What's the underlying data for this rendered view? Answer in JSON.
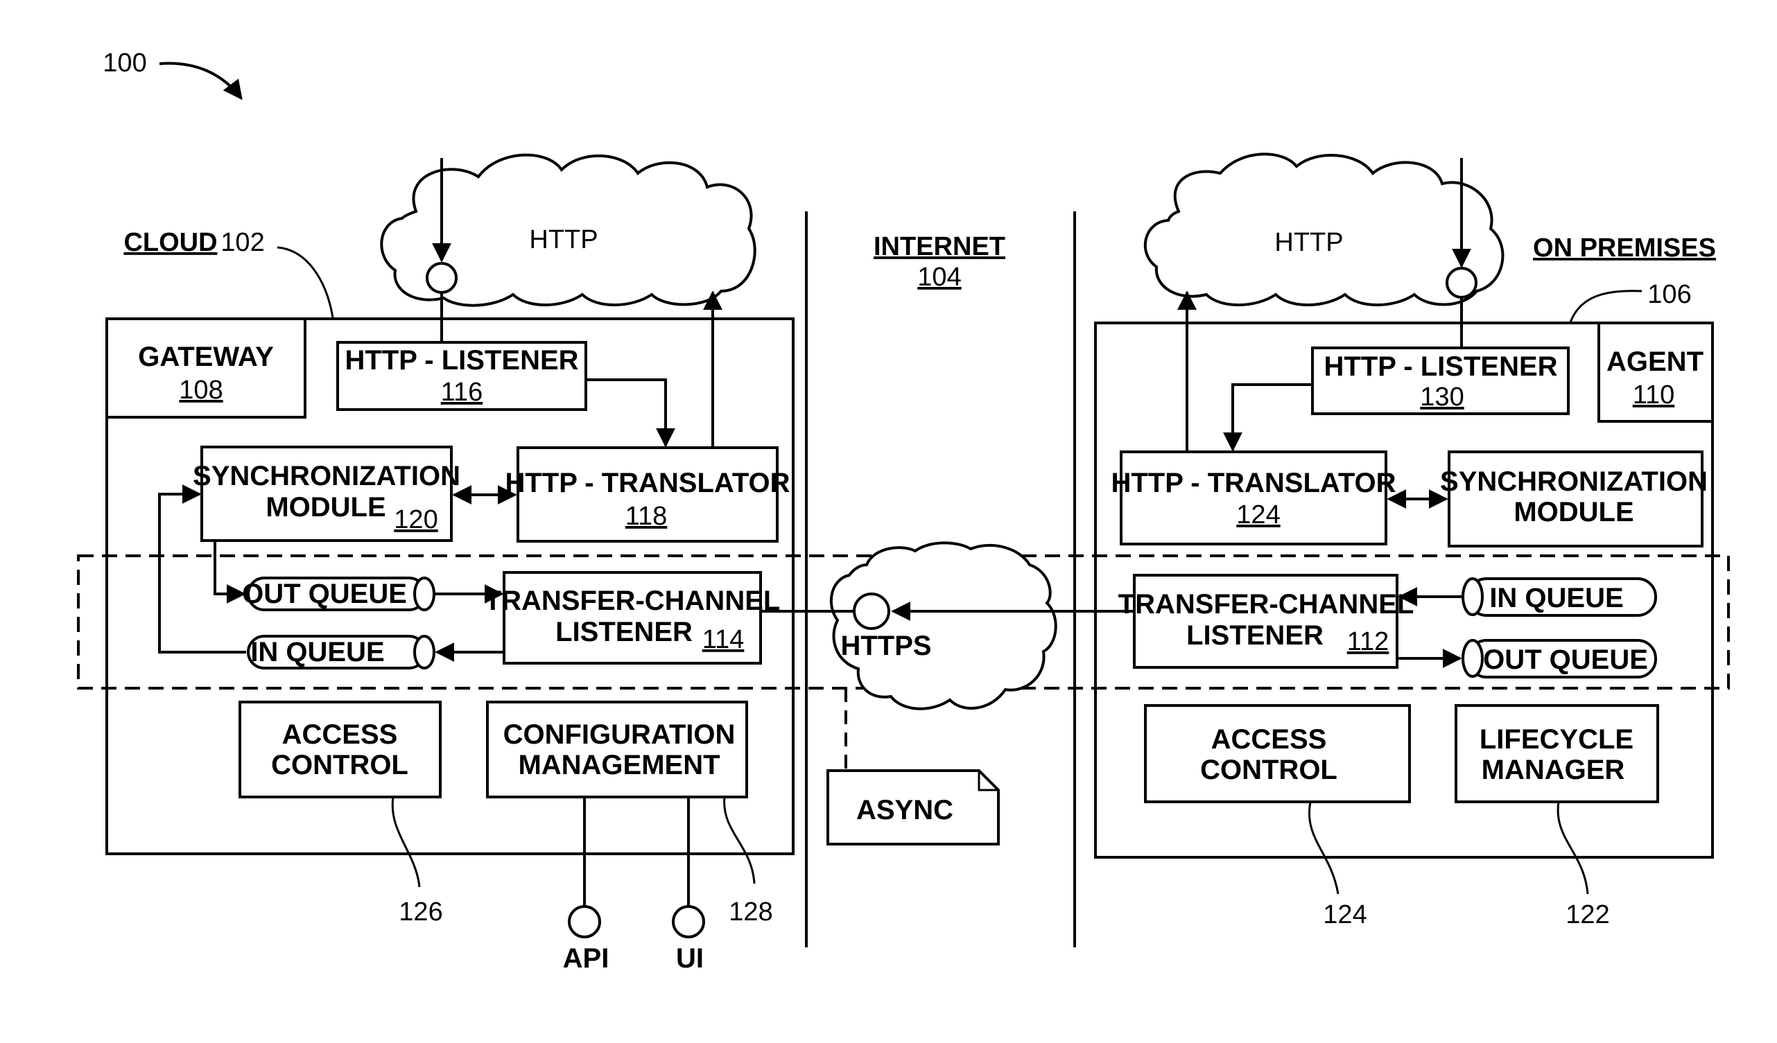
{
  "figure": {
    "ref": "100",
    "zones": {
      "cloud": {
        "label": "CLOUD",
        "ref": "102"
      },
      "internet": {
        "label": "INTERNET",
        "ref": "104"
      },
      "on_premises": {
        "label": "ON PREMISES",
        "ref": "106"
      }
    },
    "clouds": {
      "http_left": "HTTP",
      "http_right": "HTTP",
      "https": "HTTPS"
    },
    "left": {
      "gateway": {
        "label": "GATEWAY",
        "ref": "108"
      },
      "http_listener": {
        "label": "HTTP - LISTENER",
        "ref": "116"
      },
      "sync_module": {
        "line1": "SYNCHRONIZATION",
        "line2": "MODULE",
        "ref": "120"
      },
      "http_translator": {
        "label": "HTTP - TRANSLATOR",
        "ref": "118"
      },
      "out_queue": "OUT QUEUE",
      "in_queue": "IN QUEUE",
      "transfer_listener": {
        "line1": "TRANSFER-CHANNEL",
        "line2": "LISTENER",
        "ref": "114"
      },
      "access_control": {
        "line1": "ACCESS",
        "line2": "CONTROL",
        "ref": "126"
      },
      "config_mgmt": {
        "line1": "CONFIGURATION",
        "line2": "MANAGEMENT",
        "ref": "128"
      },
      "api": "API",
      "ui": "UI"
    },
    "middle": {
      "async": "ASYNC"
    },
    "right": {
      "agent": {
        "label": "AGENT",
        "ref": "110"
      },
      "http_listener": {
        "label": "HTTP - LISTENER",
        "ref": "130"
      },
      "http_translator": {
        "label": "HTTP - TRANSLATOR",
        "ref": "124"
      },
      "sync_module": {
        "line1": "SYNCHRONIZATION",
        "line2": "MODULE"
      },
      "transfer_listener": {
        "line1": "TRANSFER-CHANNEL",
        "line2": "LISTENER",
        "ref": "112"
      },
      "in_queue": "IN QUEUE",
      "out_queue": "OUT QUEUE",
      "access_control": {
        "line1": "ACCESS",
        "line2": "CONTROL",
        "ref": "124"
      },
      "lifecycle_manager": {
        "line1": "LIFECYCLE",
        "line2": "MANAGER",
        "ref": "122"
      }
    }
  }
}
